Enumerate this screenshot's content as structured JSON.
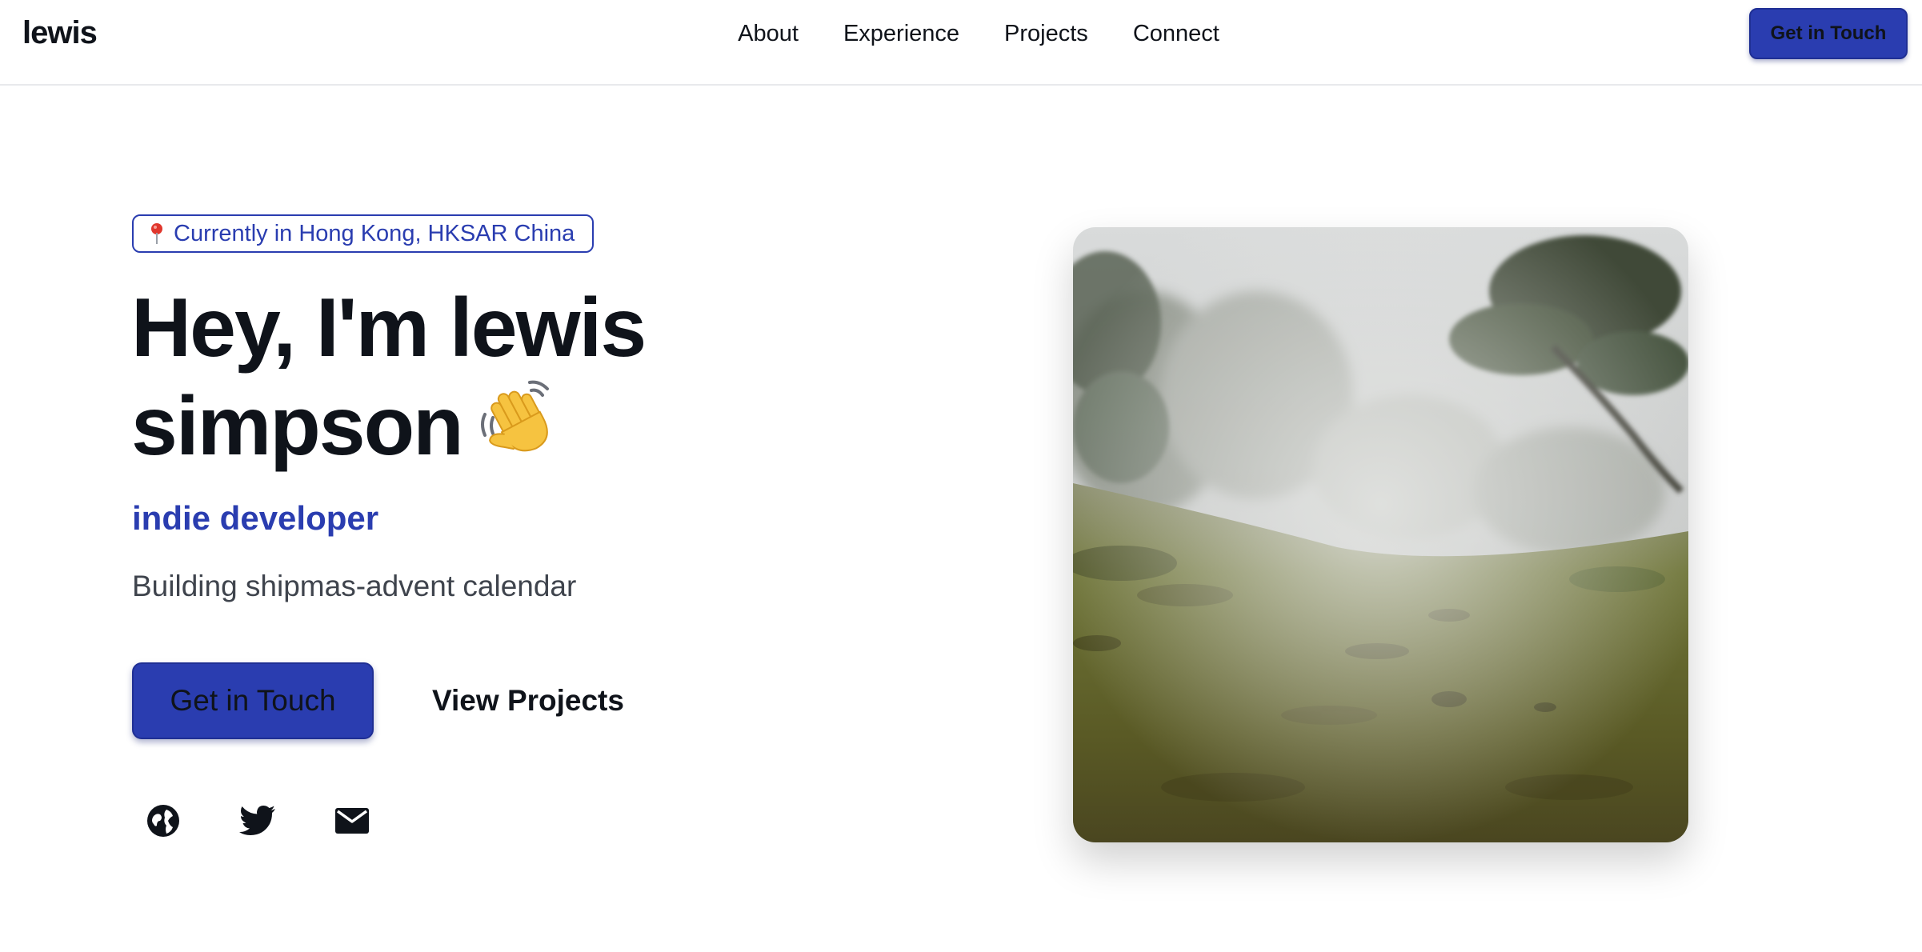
{
  "header": {
    "logo": "lewis",
    "nav": [
      "About",
      "Experience",
      "Projects",
      "Connect"
    ],
    "cta_label": "Get in Touch"
  },
  "hero": {
    "location": "Currently in Hong Kong, HKSAR China",
    "title_line1": "Hey, I'm lewis",
    "title_line2": "simpson",
    "role": "indie developer",
    "status": "Building shipmas-advent calendar",
    "primary_button": "Get in Touch",
    "secondary_button": "View Projects"
  },
  "socials": [
    {
      "icon": "globe-icon"
    },
    {
      "icon": "twitter-icon"
    },
    {
      "icon": "mail-icon"
    }
  ],
  "colors": {
    "accent": "#2a3db0",
    "text": "#0f131a",
    "muted": "#3f444d"
  }
}
